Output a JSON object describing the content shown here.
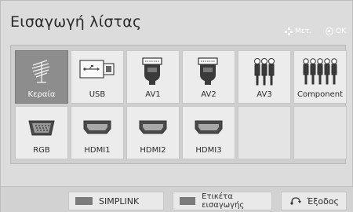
{
  "header": {
    "title": "Εισαγωγή λίστας",
    "move_hint": "Μετ.",
    "ok_hint": "OK"
  },
  "inputs": {
    "row1": [
      {
        "label": "Κεραία",
        "icon": "antenna-icon",
        "selected": true
      },
      {
        "label": "USB",
        "icon": "usb-icon",
        "selected": false
      },
      {
        "label": "AV1",
        "icon": "scart-icon",
        "selected": false
      },
      {
        "label": "AV2",
        "icon": "scart-icon",
        "selected": false
      },
      {
        "label": "AV3",
        "icon": "rca-icon",
        "selected": false
      },
      {
        "label": "Component",
        "icon": "component-rca-icon",
        "selected": false
      }
    ],
    "row2": [
      {
        "label": "RGB",
        "icon": "vga-icon",
        "selected": false
      },
      {
        "label": "HDMI1",
        "icon": "hdmi-icon",
        "selected": false
      },
      {
        "label": "HDMI2",
        "icon": "hdmi-icon",
        "selected": false
      },
      {
        "label": "HDMI3",
        "icon": "hdmi-icon",
        "selected": false
      },
      {
        "label": "",
        "icon": "",
        "selected": false
      },
      {
        "label": "",
        "icon": "",
        "selected": false
      }
    ]
  },
  "footer": {
    "simplink_label": "SIMPLINK",
    "input_label_label": "Ετικέτα εισαγωγής",
    "exit_label": "Έξοδος"
  },
  "colors": {
    "panel_bg": "#dcdcdc",
    "tile_bg": "#ececec",
    "selected_tile_bg": "#8d8d8d",
    "swatch": "#7b7b7b"
  }
}
